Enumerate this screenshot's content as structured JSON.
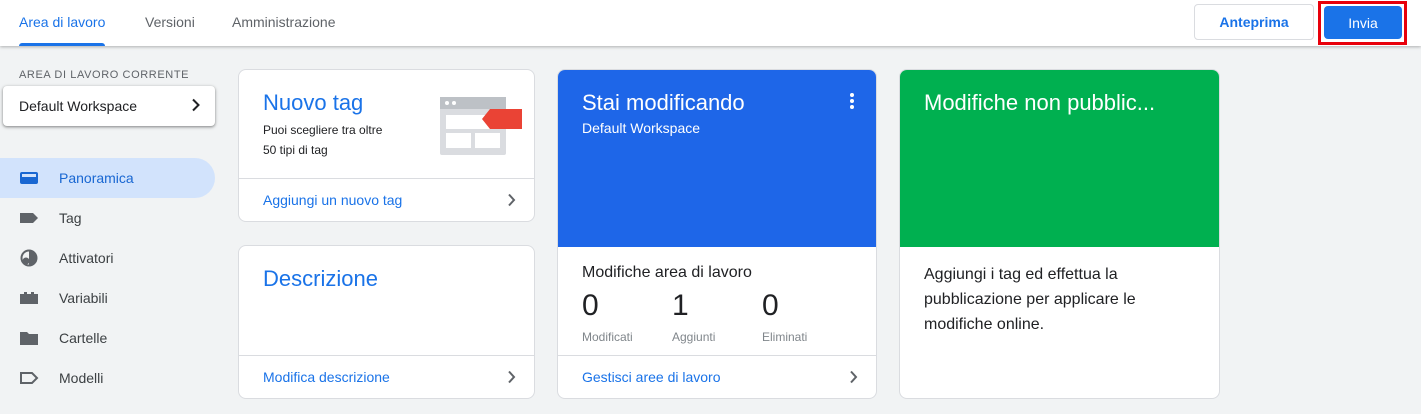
{
  "header": {
    "tabs": [
      {
        "label": "Area di lavoro",
        "active": true
      },
      {
        "label": "Versioni",
        "active": false
      },
      {
        "label": "Amministrazione",
        "active": false
      }
    ],
    "preview_label": "Anteprima",
    "submit_label": "Invia"
  },
  "sidebar": {
    "section_label": "AREA DI LAVORO CORRENTE",
    "workspace_name": "Default Workspace",
    "items": [
      {
        "label": "Panoramica",
        "icon": "overview-icon",
        "active": true
      },
      {
        "label": "Tag",
        "icon": "tag-icon",
        "active": false
      },
      {
        "label": "Attivatori",
        "icon": "trigger-icon",
        "active": false
      },
      {
        "label": "Variabili",
        "icon": "variable-icon",
        "active": false
      },
      {
        "label": "Cartelle",
        "icon": "folder-icon",
        "active": false
      },
      {
        "label": "Modelli",
        "icon": "template-icon",
        "active": false
      }
    ]
  },
  "cards": {
    "new_tag": {
      "title": "Nuovo tag",
      "line1": "Puoi scegliere tra oltre",
      "line2": "50 tipi di tag",
      "link": "Aggiungi un nuovo tag"
    },
    "description": {
      "title": "Descrizione",
      "link": "Modifica descrizione"
    },
    "editing": {
      "title": "Stai modificando",
      "subtitle": "Default Workspace",
      "changes_title": "Modifiche area di lavoro",
      "stats": [
        {
          "value": "0",
          "label": "Modificati"
        },
        {
          "value": "1",
          "label": "Aggiunti"
        },
        {
          "value": "0",
          "label": "Eliminati"
        }
      ],
      "link": "Gestisci aree di lavoro"
    },
    "unpublished": {
      "title": "Modifiche non pubblic...",
      "line1": "Aggiungi i tag ed effettua la",
      "line2": "pubblicazione per applicare le",
      "line3": "modifiche online."
    }
  },
  "colors": {
    "accent": "#1a73e8",
    "editing_bg": "#1e66e8",
    "unpublished_bg": "#00b050",
    "highlight": "#e8000b"
  }
}
